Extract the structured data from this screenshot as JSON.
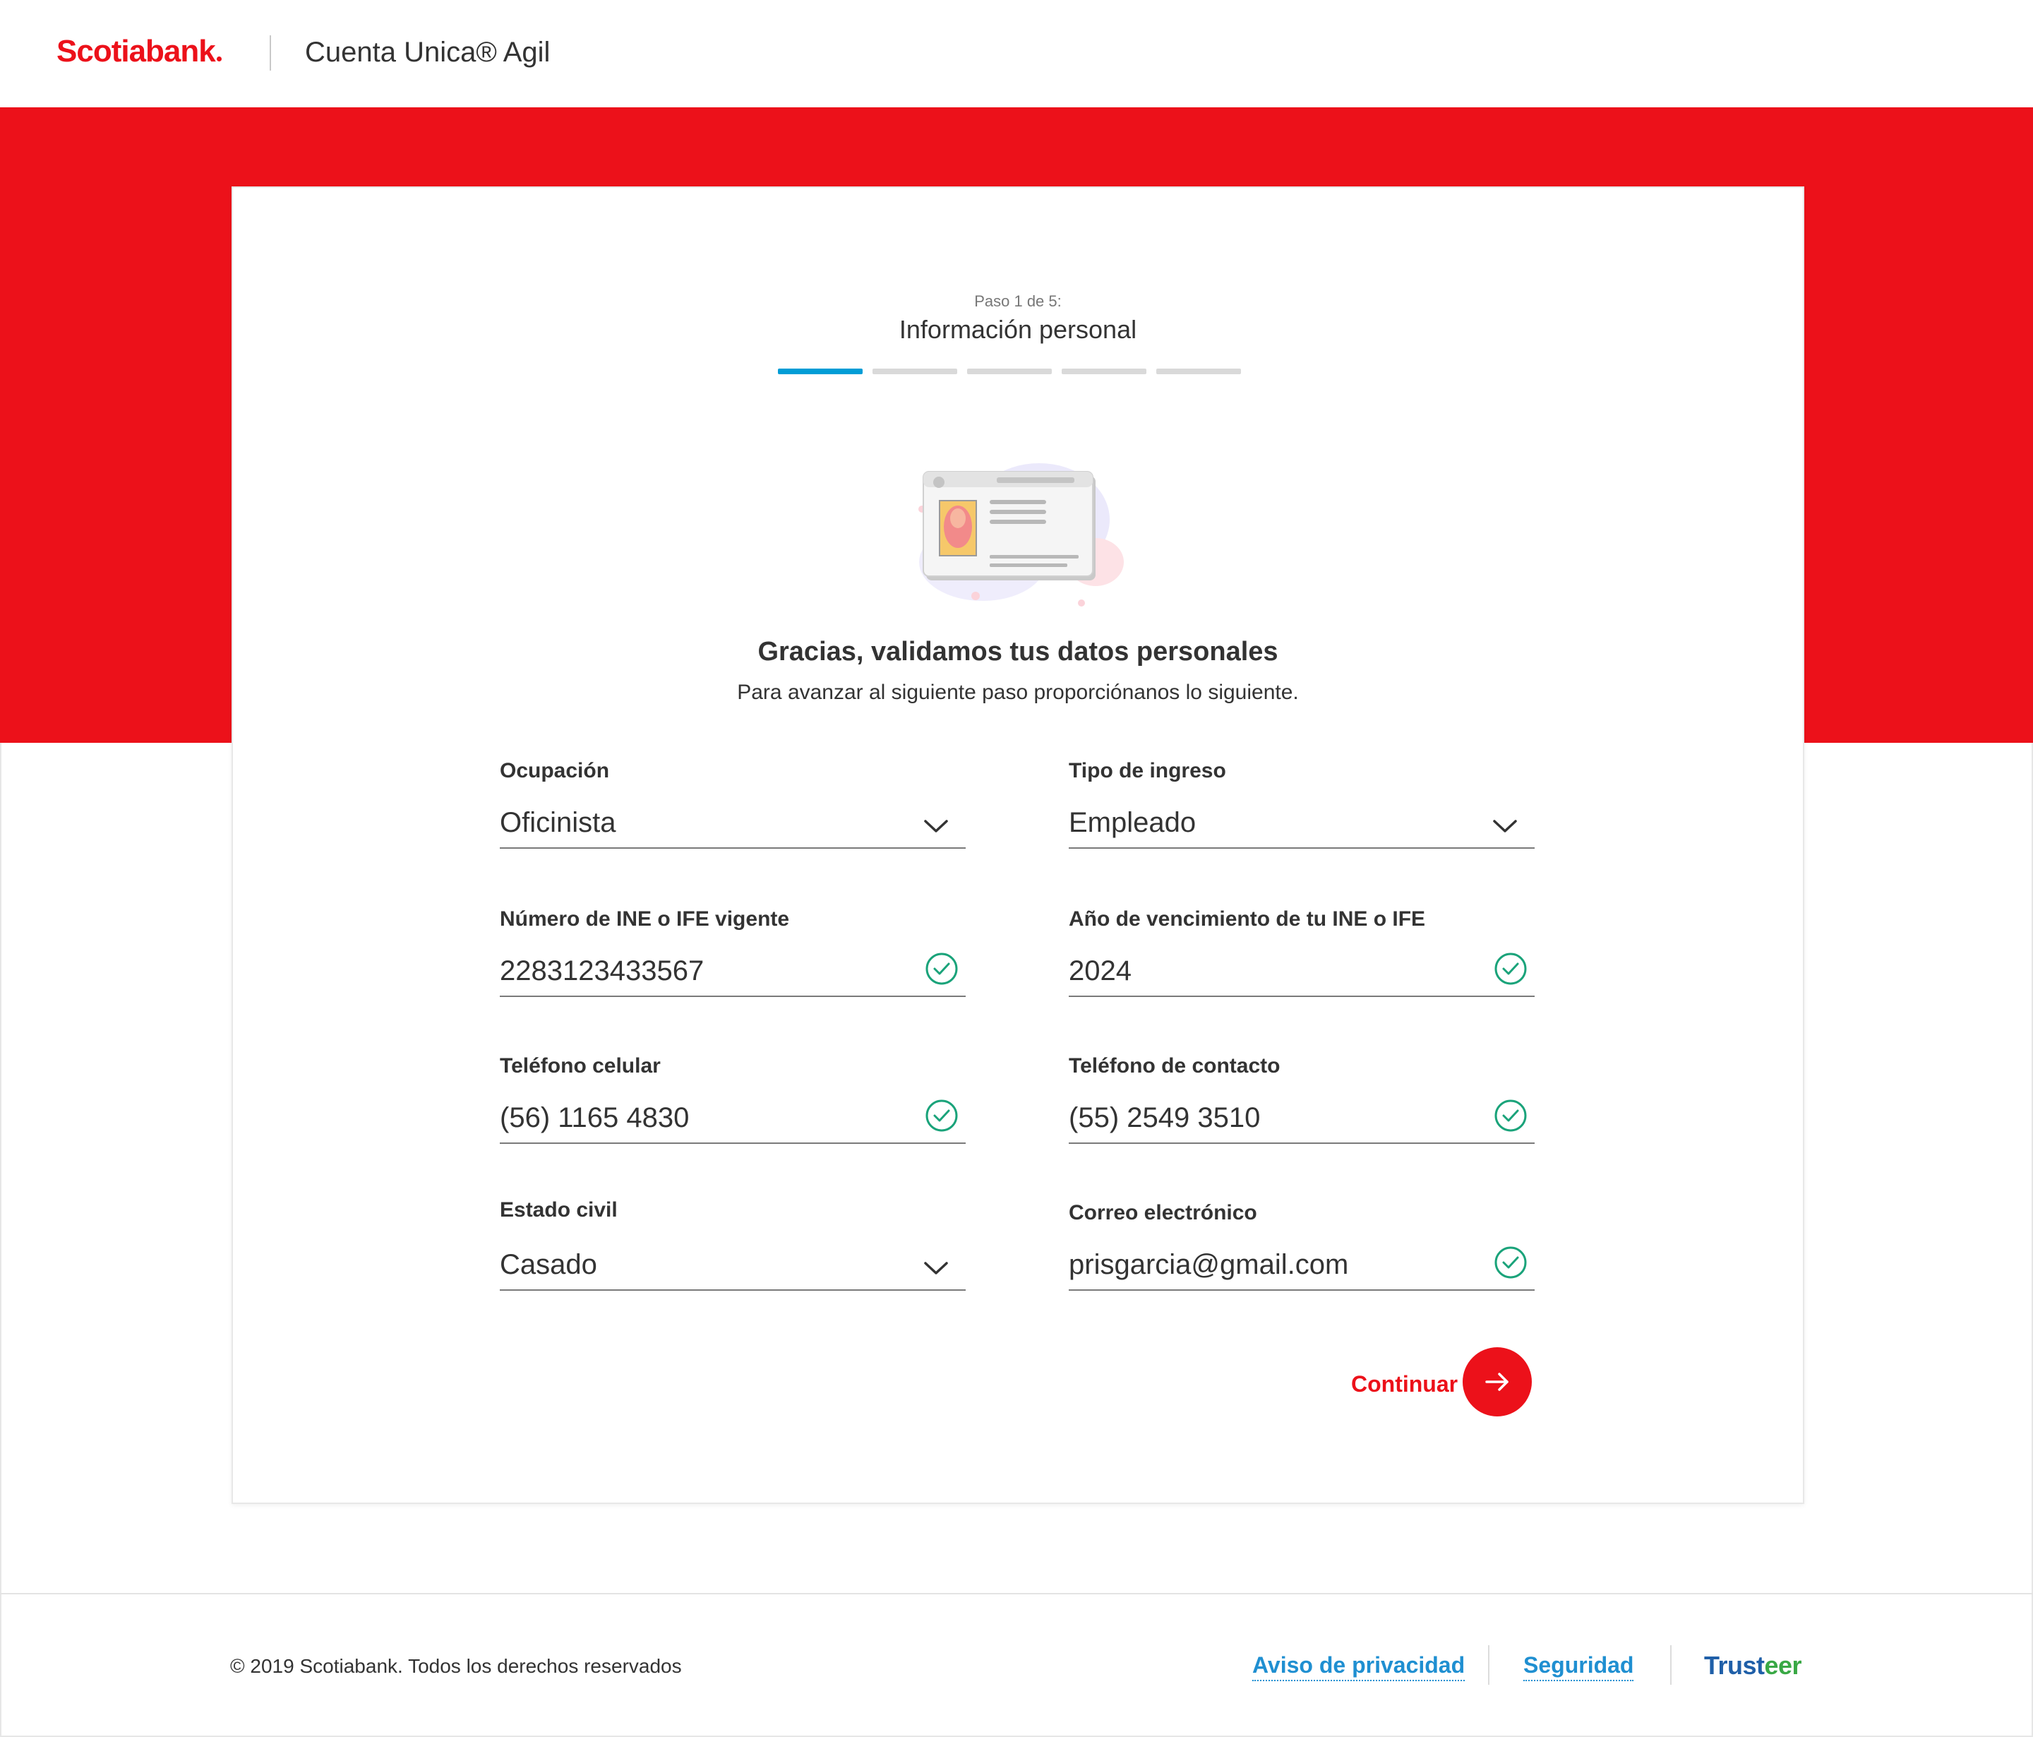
{
  "header": {
    "logo_text": "Scotiabank",
    "product_name": "Cuenta Unica® Agil"
  },
  "progress": {
    "step_label": "Paso 1 de 5:",
    "step_title": "Información personal",
    "current_step": 1,
    "total_steps": 5
  },
  "intro": {
    "heading": "Gracias, validamos tus datos personales",
    "subheading": "Para avanzar al siguiente paso proporciónanos lo siguiente."
  },
  "form": {
    "ocupacion": {
      "label": "Ocupación",
      "value": "Oficinista"
    },
    "tipo_ingreso": {
      "label": "Tipo de ingreso",
      "value": "Empleado"
    },
    "numero_ine": {
      "label": "Número de INE o IFE vigente",
      "value": "2283123433567"
    },
    "anio_vencimiento": {
      "label": "Año de vencimiento de tu INE o IFE",
      "value": "2024"
    },
    "telefono_celular": {
      "label": "Teléfono celular",
      "value": "(56) 1165 4830"
    },
    "telefono_contacto": {
      "label": "Teléfono de contacto",
      "value": "(55) 2549 3510"
    },
    "estado_civil": {
      "label": "Estado civil",
      "value": "Casado"
    },
    "correo": {
      "label": "Correo electrónico",
      "value": "prisgarcia@gmail.com"
    }
  },
  "actions": {
    "continue_label": "Continuar"
  },
  "footer": {
    "copyright": "© 2019 Scotiabank. Todos los derechos reservados",
    "privacy_link": "Aviso de privacidad",
    "security_link": "Seguridad",
    "trusteer_part1": "Trust",
    "trusteer_part2": "eer"
  },
  "colors": {
    "brand_red": "#ec111a",
    "progress_active": "#009dd6",
    "valid_check": "#1aa37a",
    "link_blue": "#1f8fd1"
  },
  "icons": {
    "dropdown": "chevron-down-icon",
    "valid": "check-circle-icon",
    "continue": "arrow-right-icon"
  }
}
